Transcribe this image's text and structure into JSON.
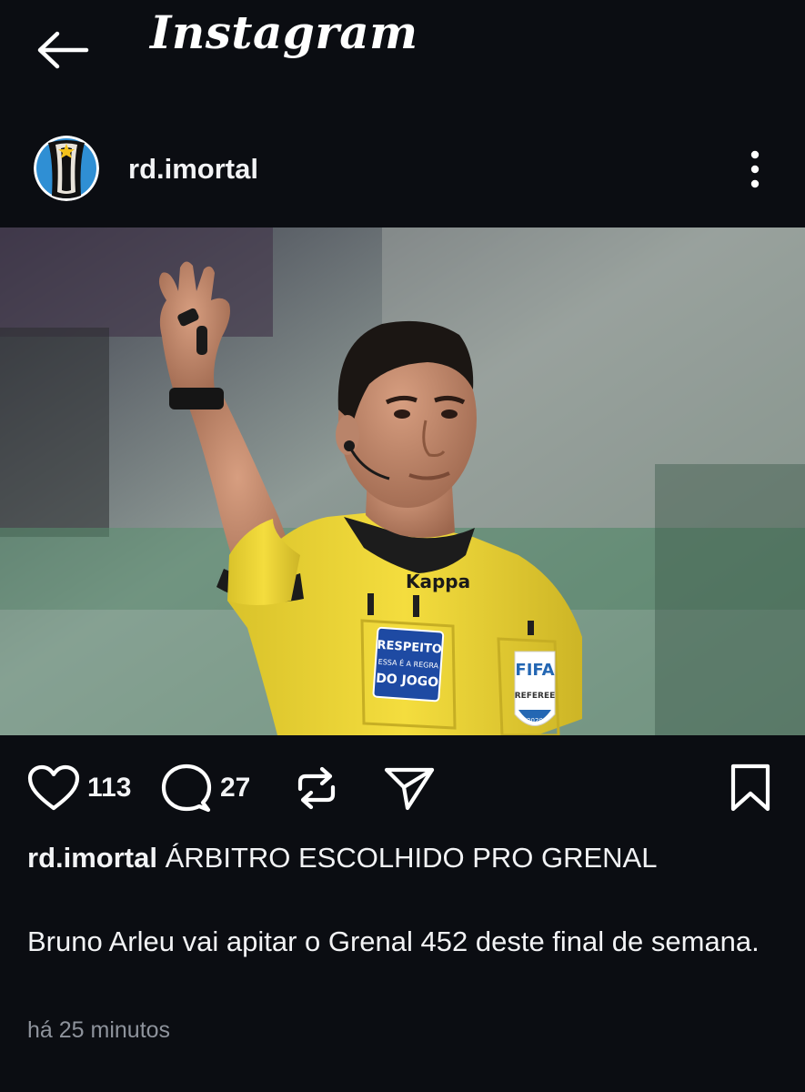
{
  "app": {
    "title": "Instagram"
  },
  "post": {
    "username": "rd.imortal",
    "likes_count": "113",
    "comments_count": "27",
    "caption_title": "ÁRBITRO ESCOLHIDO PRO GRENAL",
    "caption_body": "Bruno Arleu vai apitar o Grenal 452 deste final de semana.",
    "timestamp": "há 25 minutos"
  },
  "image": {
    "jersey_badge_text": [
      "RESPEITO",
      "ESSA É A REGRA",
      "DO JOGO"
    ],
    "fifa_badge_text": [
      "FIFA",
      "REFEREE",
      "2020"
    ],
    "kit_logo": "Kappa"
  },
  "icons": {
    "back": "arrow-left-icon",
    "more": "more-vertical-icon",
    "like": "heart-icon",
    "comment": "comment-bubble-icon",
    "repost": "repost-icon",
    "share": "send-icon",
    "save": "bookmark-icon"
  },
  "colors": {
    "background": "#0b0d12",
    "text": "#f2f3f5",
    "muted": "#8e939c",
    "referee_shirt": "#f1d738"
  }
}
